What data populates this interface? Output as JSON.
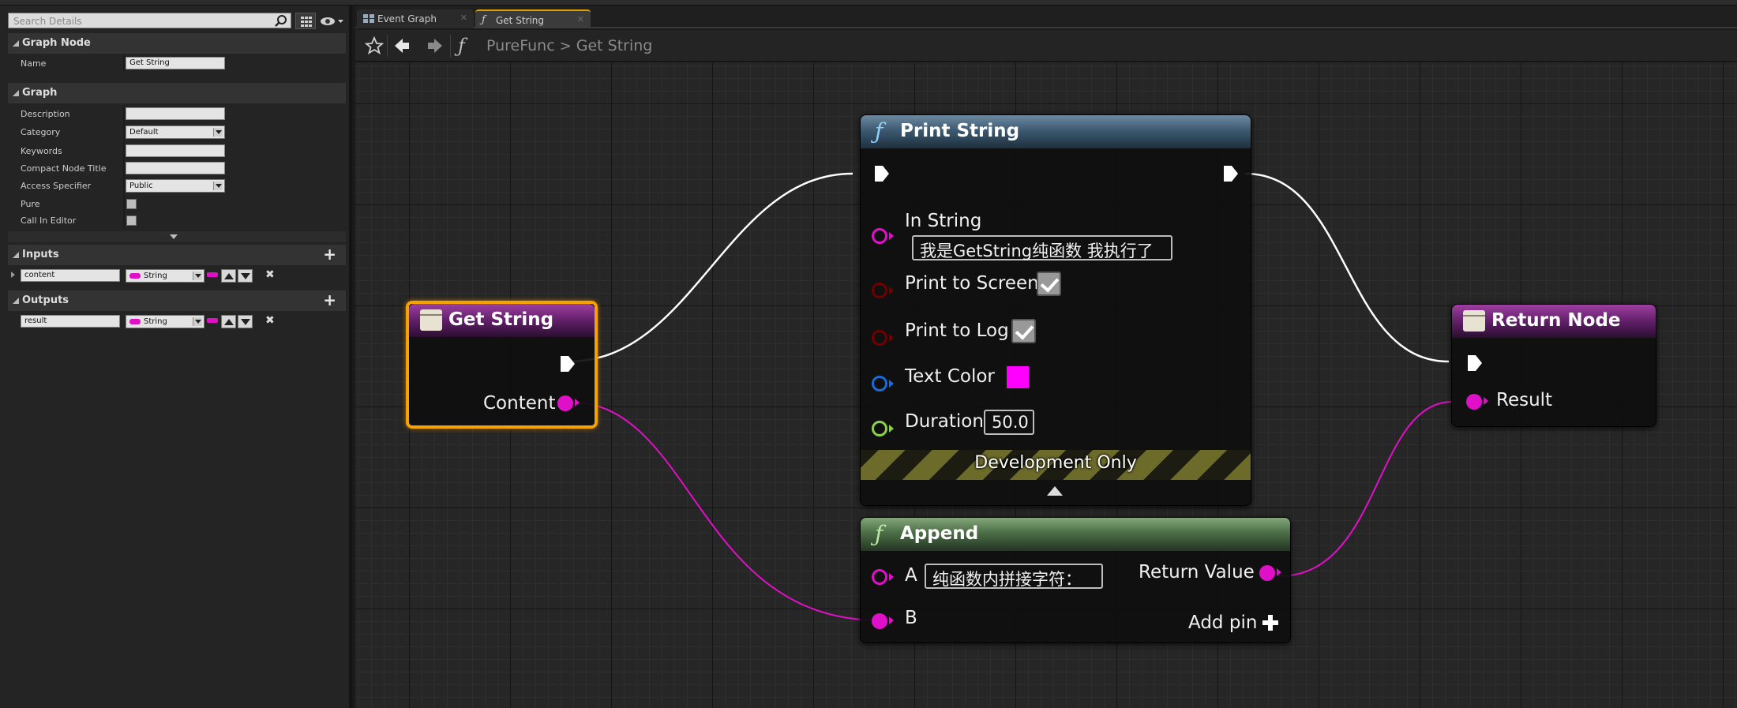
{
  "details": {
    "search_placeholder": "Search Details",
    "sections": {
      "graph_node": "Graph Node",
      "graph": "Graph",
      "inputs": "Inputs",
      "outputs": "Outputs"
    },
    "graph_node": {
      "name_label": "Name",
      "name_value": "Get String"
    },
    "graph": {
      "description_label": "Description",
      "description_value": "",
      "category_label": "Category",
      "category_value": "Default",
      "keywords_label": "Keywords",
      "keywords_value": "",
      "compact_title_label": "Compact Node Title",
      "compact_title_value": "",
      "access_label": "Access Specifier",
      "access_value": "Public",
      "pure_label": "Pure",
      "call_in_editor_label": "Call In Editor"
    },
    "inputs": [
      {
        "name": "content",
        "type": "String"
      }
    ],
    "outputs": [
      {
        "name": "result",
        "type": "String"
      }
    ]
  },
  "tabs": [
    {
      "label": "Event Graph",
      "icon": "event-graph-icon"
    },
    {
      "label": "Get String",
      "icon": "function-icon"
    }
  ],
  "breadcrumb": {
    "root": "PureFunc",
    "separator": ">",
    "current": "Get String"
  },
  "nodes": {
    "get_string": {
      "title": "Get String",
      "content_label": "Content"
    },
    "print_string": {
      "title": "Print String",
      "in_string_label": "In String",
      "in_string_value": "我是GetString纯函数 我执行了",
      "print_to_screen_label": "Print to Screen",
      "print_to_log_label": "Print to Log",
      "text_color_label": "Text Color",
      "text_color_value": "#ff00ff",
      "duration_label": "Duration",
      "duration_value": "50.0",
      "dev_only_label": "Development Only"
    },
    "append": {
      "title": "Append",
      "a_label": "A",
      "a_value": "纯函数内拼接字符：",
      "b_label": "B",
      "return_label": "Return Value",
      "add_pin_label": "Add pin"
    },
    "return_node": {
      "title": "Return Node",
      "result_label": "Result"
    }
  },
  "colors": {
    "string_pin": "#e010c8",
    "bool_pin": "#8b0000",
    "struct_pin": "#1a6ad8",
    "float_pin": "#8ad14b",
    "exec_wire": "#ffffff",
    "selected_border": "#f5a300"
  }
}
